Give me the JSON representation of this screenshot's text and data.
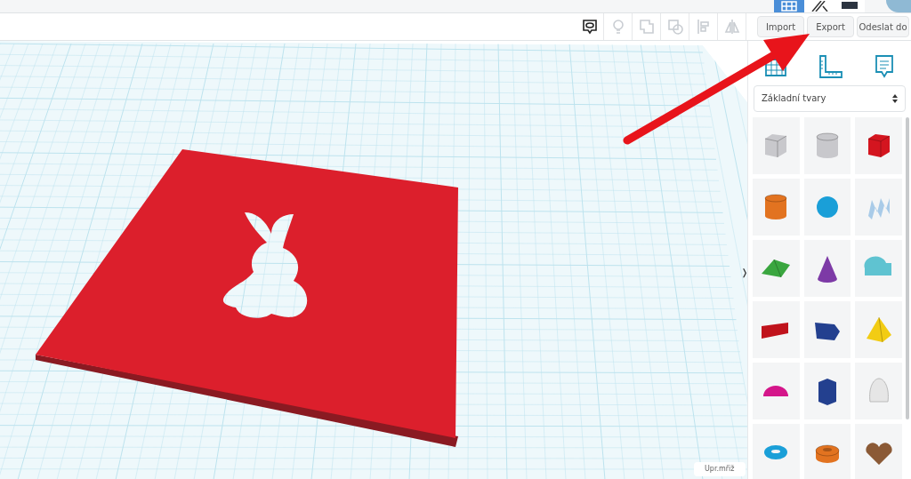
{
  "top_bar": {
    "views": [
      {
        "kind": "grid",
        "selected": true
      },
      {
        "kind": "blocks",
        "selected": false
      },
      {
        "kind": "bricks",
        "selected": false
      }
    ]
  },
  "toolbar": {
    "tools": [
      {
        "kind": "notes",
        "disabled": false
      },
      {
        "kind": "bulb",
        "disabled": true
      },
      {
        "kind": "group",
        "disabled": true
      },
      {
        "kind": "ungroup",
        "disabled": true
      },
      {
        "kind": "align",
        "disabled": true
      },
      {
        "kind": "mirror",
        "disabled": true
      }
    ],
    "buttons": [
      "Import",
      "Export",
      "Odeslat do"
    ]
  },
  "canvas": {
    "grid_button": "Upr.mřiž",
    "panel_toggle": "❭"
  },
  "panel": {
    "tabs": [
      {
        "kind": "workplane"
      },
      {
        "kind": "ruler"
      },
      {
        "kind": "notes"
      }
    ],
    "library": "Základní tvary",
    "shapes": [
      {
        "kind": "box",
        "color": "#c8c8cc"
      },
      {
        "kind": "cylinder",
        "color": "#c8c8cc"
      },
      {
        "kind": "box",
        "color": "#d4151f"
      },
      {
        "kind": "cylinder",
        "color": "#e27320"
      },
      {
        "kind": "sphere",
        "color": "#1a9fd8"
      },
      {
        "kind": "scribble",
        "color": "#a9cbe8"
      },
      {
        "kind": "roof",
        "color": "#3aa63f"
      },
      {
        "kind": "cone",
        "color": "#7d3aa6"
      },
      {
        "kind": "round-roof",
        "color": "#5fc3d1"
      },
      {
        "kind": "text",
        "color": "#c0131c"
      },
      {
        "kind": "prism",
        "color": "#23408f"
      },
      {
        "kind": "pyramid",
        "color": "#f2cc14"
      },
      {
        "kind": "half-sphere",
        "color": "#d4168a"
      },
      {
        "kind": "polygon",
        "color": "#23408f"
      },
      {
        "kind": "paraboloid",
        "color": "#e6e6e6"
      },
      {
        "kind": "torus",
        "color": "#1a9fd8"
      },
      {
        "kind": "tube",
        "color": "#e27320"
      },
      {
        "kind": "heart",
        "color": "#8b5a36"
      }
    ]
  }
}
